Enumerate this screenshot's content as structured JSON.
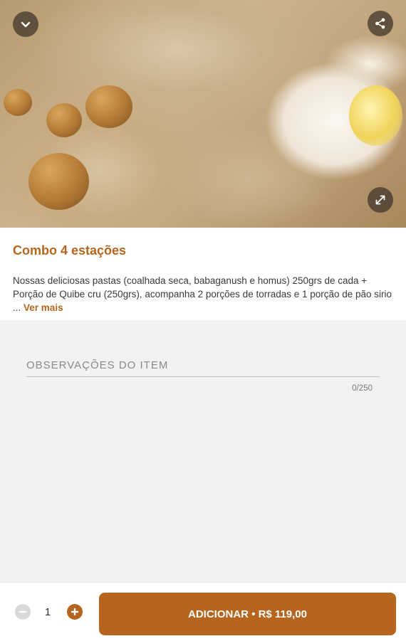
{
  "product": {
    "title": "Combo 4 estações",
    "description": "Nossas deliciosas pastas (coalhada seca, babaganush e homus) 250grs de cada + Porção de Quibe cru (250grs), acompanha 2 porções de torradas e 1 porção de pão sirio ...",
    "see_more": "Ver mais"
  },
  "observations": {
    "placeholder": "OBSERVAÇÕES DO ITEM",
    "value": "",
    "counter": "0/250"
  },
  "cart": {
    "quantity": "1",
    "add_label": "ADICIONAR • R$ 119,00"
  },
  "icons": {
    "close": "chevron-down-icon",
    "share": "share-icon",
    "expand": "expand-icon",
    "minus": "minus-icon",
    "plus": "plus-icon"
  },
  "colors": {
    "accent": "#b5651d",
    "background": "#f2f2f2",
    "disabled": "#d9d9d9"
  }
}
